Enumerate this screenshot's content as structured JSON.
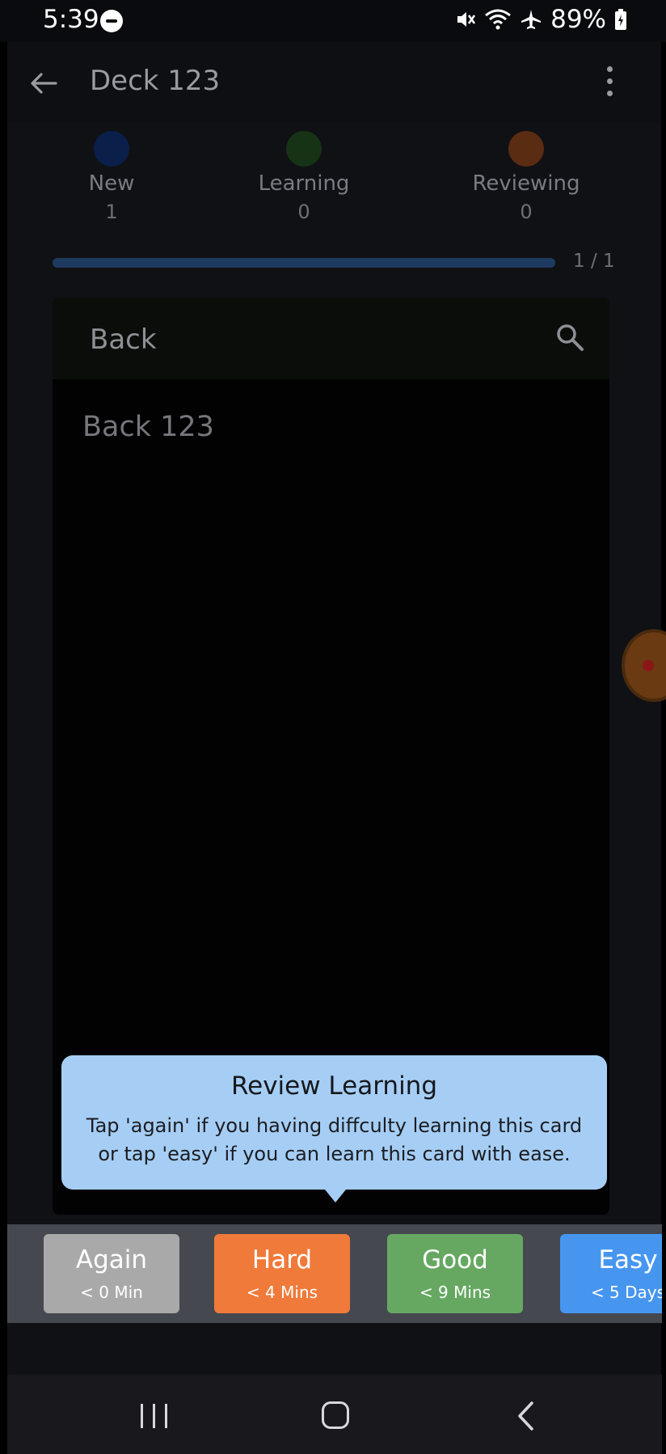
{
  "status_bar": {
    "time": "5:39",
    "battery": "89%"
  },
  "app_bar": {
    "title": "Deck 123"
  },
  "counters": [
    {
      "label": "New",
      "value": "1",
      "color": "#0a1f4a"
    },
    {
      "label": "Learning",
      "value": "0",
      "color": "#163316"
    },
    {
      "label": "Reviewing",
      "value": "0",
      "color": "#5a2c12"
    }
  ],
  "progress": {
    "text": "1 / 1",
    "fraction": 1.0
  },
  "card": {
    "header": "Back",
    "body": "Back 123"
  },
  "tooltip": {
    "title": "Review Learning",
    "text": "Tap 'again' if you having diffculty learning this card or tap 'easy' if you can learn this card with ease."
  },
  "answer_buttons": [
    {
      "label": "Again",
      "interval": "< 0 Min",
      "color": "#a9a9a9"
    },
    {
      "label": "Hard",
      "interval": "< 4 Mins",
      "color": "#f07a3a"
    },
    {
      "label": "Good",
      "interval": "< 9 Mins",
      "color": "#66a862"
    },
    {
      "label": "Easy",
      "interval": "< 5 Days",
      "color": "#4696f0"
    }
  ]
}
